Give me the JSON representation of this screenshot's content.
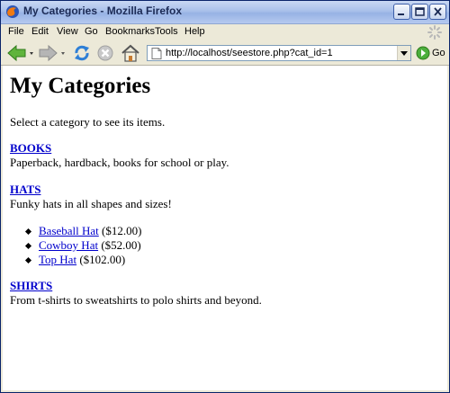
{
  "window": {
    "title": "My Categories - Mozilla Firefox"
  },
  "menu": {
    "items": [
      "File",
      "Edit",
      "View",
      "Go",
      "Bookmarks",
      "Tools",
      "Help"
    ]
  },
  "navigation": {
    "url": "http://localhost/seestore.php?cat_id=1",
    "go_label": "Go"
  },
  "page": {
    "heading": "My Categories",
    "intro": "Select a category to see its items.",
    "categories": [
      {
        "name": "BOOKS",
        "description": "Paperback, hardback, books for school or play."
      },
      {
        "name": "HATS",
        "description": "Funky hats in all shapes and sizes!"
      },
      {
        "name": "SHIRTS",
        "description": "From t-shirts to sweatshirts to polo shirts and beyond."
      }
    ],
    "items": [
      {
        "name": "Baseball Hat",
        "price": "($12.00)"
      },
      {
        "name": "Cowboy Hat",
        "price": "($52.00)"
      },
      {
        "name": "Top Hat",
        "price": "($102.00)"
      }
    ]
  },
  "icons": {
    "app": "firefox-icon",
    "back": "back-arrow-icon",
    "forward": "forward-arrow-icon",
    "reload": "reload-icon",
    "stop": "stop-icon",
    "home": "home-icon",
    "go": "go-arrow-icon",
    "throbber": "throbber-icon"
  },
  "colors": {
    "link": "#0000cc",
    "title_bar": "#a9c0ea"
  }
}
